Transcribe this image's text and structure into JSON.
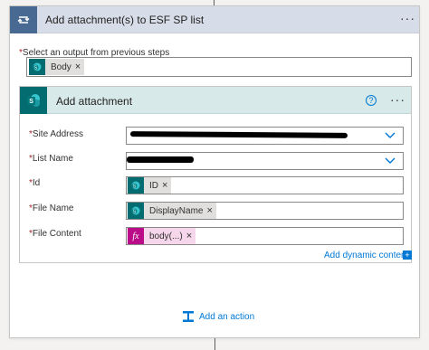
{
  "header": {
    "title": "Add attachment(s) to ESF SP list",
    "more_label": "···",
    "icon": "loop-icon"
  },
  "select_output": {
    "label": "Select an output from previous steps",
    "required_marker": "*",
    "token": {
      "label": "Body",
      "remove": "×",
      "icon": "sharepoint-icon"
    }
  },
  "action": {
    "title": "Add attachment",
    "help_label": "?",
    "more_label": "···",
    "icon": "sharepoint-icon",
    "fields": {
      "site_address": {
        "label": "Site Address",
        "required": "*"
      },
      "list_name": {
        "label": "List Name",
        "required": "*"
      },
      "id": {
        "label": "Id",
        "required": "*",
        "token": "ID",
        "remove": "×"
      },
      "file_name": {
        "label": "File Name",
        "required": "*",
        "token": "DisplayName",
        "remove": "×"
      },
      "file_content": {
        "label": "File Content",
        "required": "*",
        "token": "body(...)",
        "remove": "×",
        "token_icon": "fx"
      }
    },
    "add_dynamic_content": "Add dynamic content"
  },
  "add_action": {
    "label": "Add an action"
  },
  "colors": {
    "loop_header": "#486991",
    "sharepoint": "#036c70",
    "expression": "#ba0c88",
    "link": "#0078d4",
    "required": "#a4262c"
  }
}
